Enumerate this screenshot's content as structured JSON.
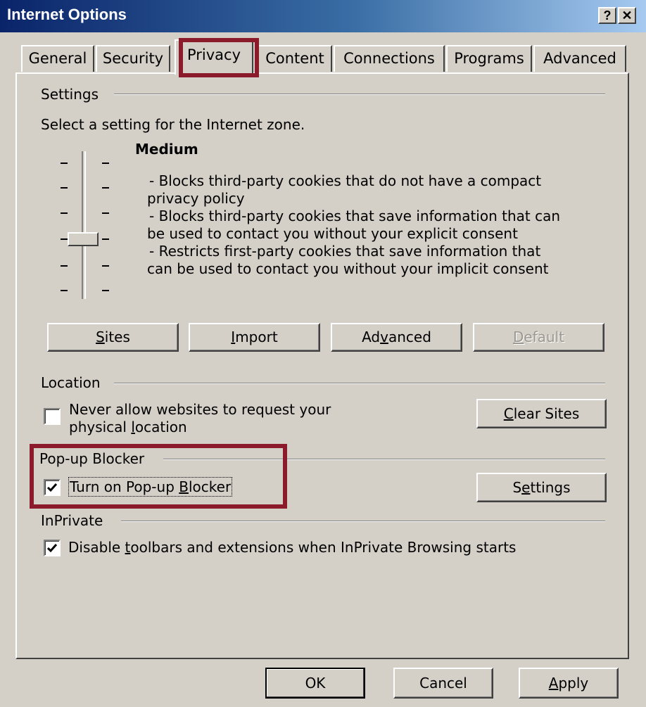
{
  "window": {
    "title": "Internet Options",
    "help_label": "?",
    "close_label": "✕"
  },
  "tabs": [
    {
      "label": "General"
    },
    {
      "label": "Security"
    },
    {
      "label": "Privacy"
    },
    {
      "label": "Content"
    },
    {
      "label": "Connections"
    },
    {
      "label": "Programs"
    },
    {
      "label": "Advanced"
    }
  ],
  "active_tab": "Privacy",
  "settings": {
    "header": "Settings",
    "zone_text": "Select a setting for the Internet zone.",
    "level_name": "Medium",
    "description": [
      "- Blocks third-party cookies that do not have a compact",
      "privacy policy",
      "- Blocks third-party cookies that save information that can",
      "be used to contact you without your explicit consent",
      "- Restricts first-party cookies that save information that",
      "can be used to contact you without your implicit consent"
    ],
    "slider_level": 3,
    "slider_levels": 6,
    "buttons": {
      "sites_hot": "S",
      "sites_rest": "ites",
      "import_hot": "I",
      "import_rest": "mport",
      "advanced_pre": "Ad",
      "advanced_hot": "v",
      "advanced_rest": "anced",
      "default_hot": "D",
      "default_rest": "efault"
    }
  },
  "location": {
    "header": "Location",
    "checkbox_line1": "Never allow websites to request your",
    "checkbox_line2_pre": "physical ",
    "checkbox_line2_hot": "l",
    "checkbox_line2_rest": "ocation",
    "checked": false,
    "clear_hot": "C",
    "clear_rest": "lear Sites"
  },
  "popup": {
    "header": "Pop-up Blocker",
    "checkbox_pre": "Turn on Pop-up ",
    "checkbox_hot": "B",
    "checkbox_rest": "locker",
    "checked": true,
    "settings_pre": "S",
    "settings_hot": "e",
    "settings_rest": "ttings"
  },
  "inprivate": {
    "header": "InPrivate",
    "checkbox_pre": "Disable ",
    "checkbox_hot": "t",
    "checkbox_rest": "oolbars and extensions when InPrivate Browsing starts",
    "checked": true
  },
  "footer": {
    "ok": "OK",
    "cancel": "Cancel",
    "apply_hot": "A",
    "apply_rest": "pply"
  },
  "colors": {
    "highlight_box": "#8b1a2b",
    "dialog_face": "#d4d0c8",
    "title_start": "#0a246a",
    "title_end": "#a6caf0"
  }
}
